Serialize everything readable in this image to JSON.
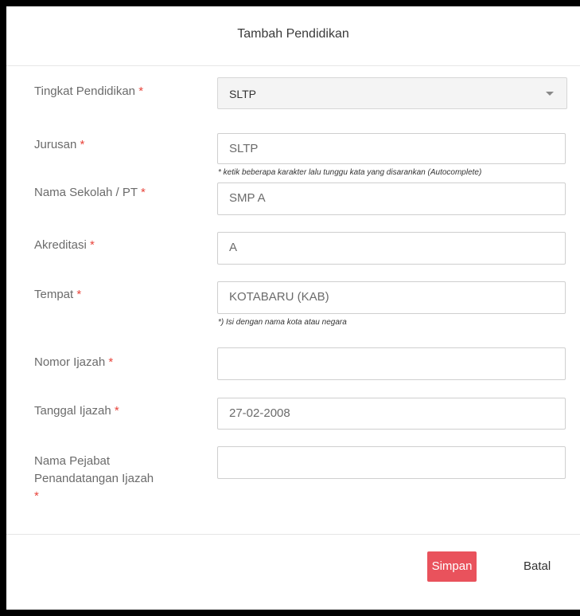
{
  "modal": {
    "title": "Tambah Pendidikan"
  },
  "required_mark": "*",
  "fields": {
    "tingkat": {
      "label": "Tingkat Pendidikan",
      "value": "SLTP"
    },
    "jurusan": {
      "label": "Jurusan",
      "value": "SLTP",
      "hint": "* ketik beberapa karakter lalu tunggu kata yang disarankan (Autocomplete)"
    },
    "sekolah": {
      "label": "Nama Sekolah / PT",
      "value": "SMP A"
    },
    "akreditasi": {
      "label": "Akreditasi",
      "value": "A"
    },
    "tempat": {
      "label": "Tempat",
      "value": "KOTABARU (KAB)",
      "hint": "*) Isi dengan nama kota atau negara"
    },
    "nomor_ijazah": {
      "label": "Nomor Ijazah",
      "value": ""
    },
    "tanggal_ijazah": {
      "label": "Tanggal Ijazah",
      "value": "27-02-2008"
    },
    "pejabat": {
      "label_line1": "Nama Pejabat",
      "label_line2": "Penandatangan Ijazah",
      "value": ""
    }
  },
  "buttons": {
    "save": "Simpan",
    "cancel": "Batal"
  },
  "colors": {
    "required": "#e8453c",
    "save_bg": "#e9525c"
  },
  "icons": {
    "select_caret": "caret-down-icon"
  }
}
